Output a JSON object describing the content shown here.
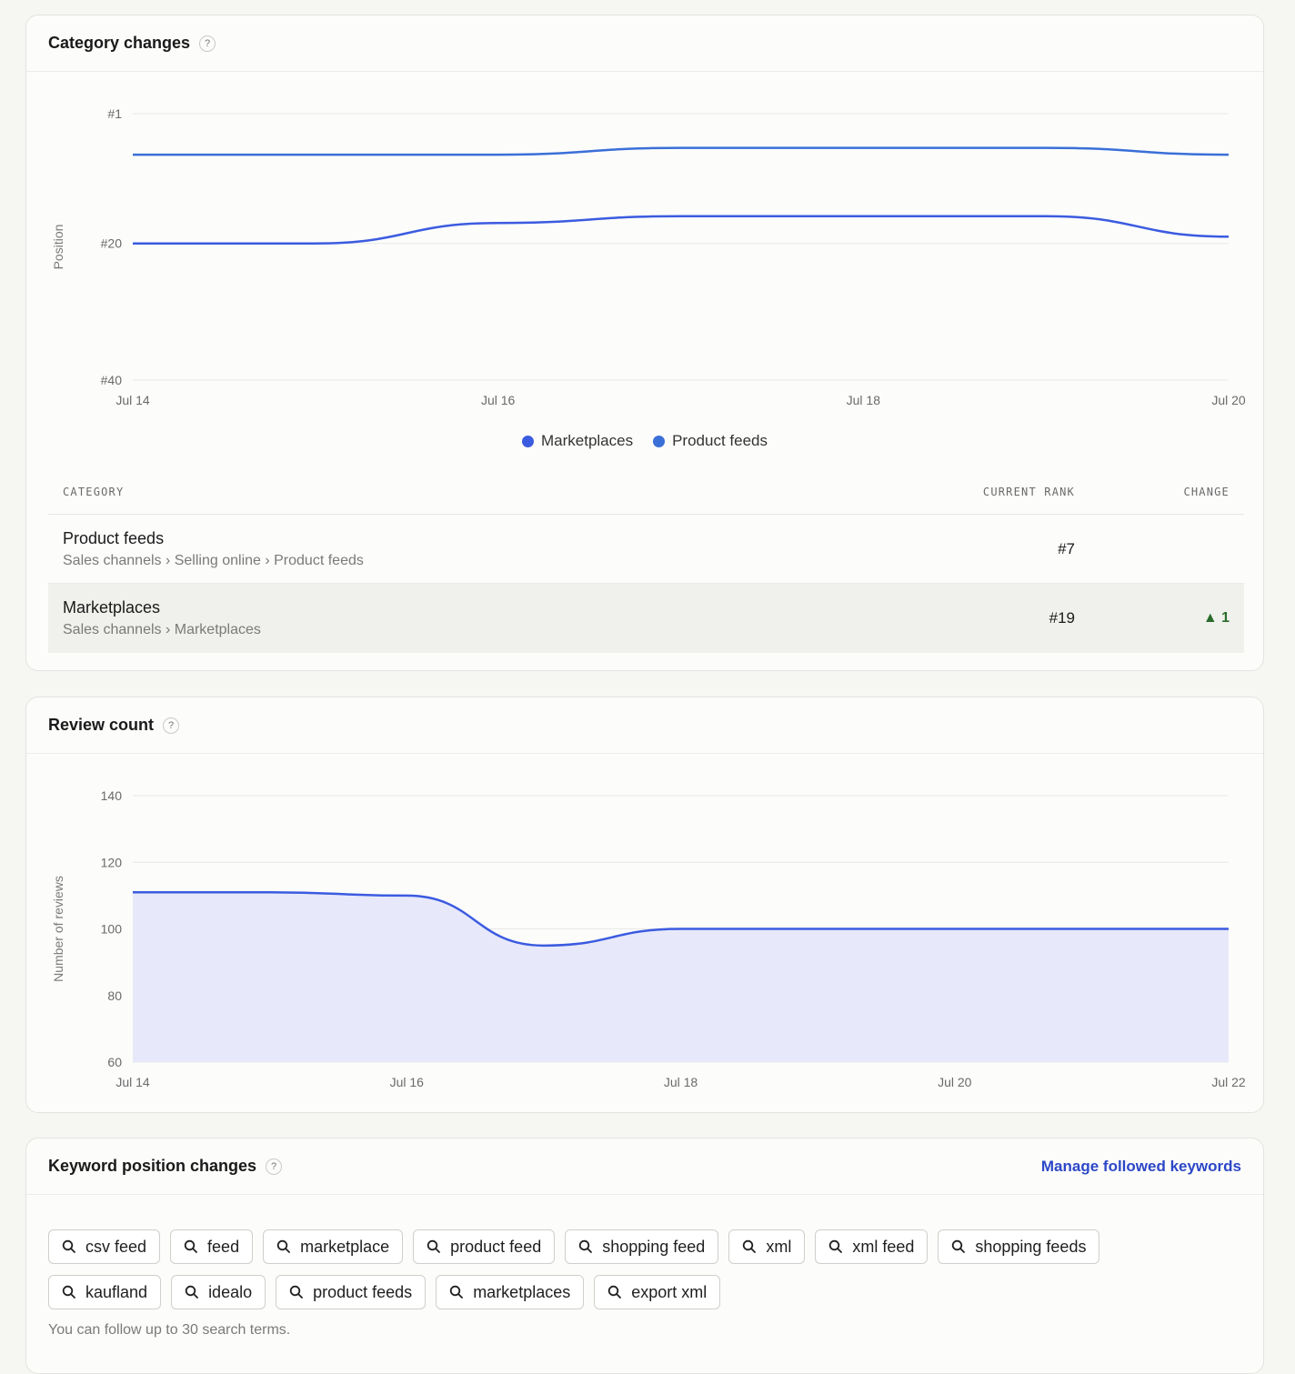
{
  "category_changes": {
    "title": "Category changes",
    "help_icon": "?",
    "chart_data": {
      "type": "line",
      "ylabel": "Position",
      "y_ticks": [
        "#1",
        "#20",
        "#40"
      ],
      "y_tick_values": [
        1,
        20,
        40
      ],
      "ylim": [
        1,
        40
      ],
      "y_inverted": true,
      "x_ticks": [
        "Jul 14",
        "Jul 16",
        "Jul 18",
        "Jul 20"
      ],
      "x": [
        "Jul 14",
        "Jul 15",
        "Jul 16",
        "Jul 17",
        "Jul 18",
        "Jul 19",
        "Jul 20"
      ],
      "series": [
        {
          "name": "Marketplaces",
          "color": "#3b5be0",
          "values": [
            20,
            20,
            17,
            16,
            16,
            16,
            19
          ]
        },
        {
          "name": "Product feeds",
          "color": "#3a6fd8",
          "values": [
            7,
            7,
            7,
            6,
            6,
            6,
            7
          ]
        }
      ],
      "grid": true,
      "legend_position": "bottom-center"
    },
    "legend": [
      {
        "label": "Marketplaces",
        "color": "#3b5be0"
      },
      {
        "label": "Product feeds",
        "color": "#3a6fd8"
      }
    ],
    "table": {
      "headers": {
        "category": "CATEGORY",
        "current_rank": "CURRENT RANK",
        "change": "CHANGE"
      },
      "rows": [
        {
          "name": "Product feeds",
          "path": "Sales channels › Selling online › Product feeds",
          "rank": "#7",
          "change": ""
        },
        {
          "name": "Marketplaces",
          "path": "Sales channels › Marketplaces",
          "rank": "#19",
          "change": "▲ 1"
        }
      ]
    }
  },
  "review_count": {
    "title": "Review count",
    "help_icon": "?",
    "chart_data": {
      "type": "area",
      "ylabel": "Number of reviews",
      "y_ticks": [
        "140",
        "120",
        "100",
        "80",
        "60"
      ],
      "ylim": [
        60,
        140
      ],
      "x_ticks": [
        "Jul 14",
        "Jul 16",
        "Jul 18",
        "Jul 20",
        "Jul 22"
      ],
      "x": [
        "Jul 14",
        "Jul 15",
        "Jul 16",
        "Jul 17",
        "Jul 18",
        "Jul 19",
        "Jul 20",
        "Jul 21",
        "Jul 22"
      ],
      "series": [
        {
          "name": "Reviews",
          "color": "#3b5be0",
          "values": [
            111,
            111,
            110,
            95,
            100,
            100,
            100,
            100,
            100
          ]
        }
      ],
      "grid": true
    }
  },
  "keyword_changes": {
    "title": "Keyword position changes",
    "help_icon": "?",
    "manage_link": "Manage followed keywords",
    "chip_icon": "search-icon",
    "keyword_rows": [
      [
        "csv feed",
        "feed",
        "marketplace",
        "product feed",
        "shopping feed",
        "xml",
        "xml feed",
        "shopping feeds"
      ],
      [
        "kaufland",
        "idealo",
        "product feeds",
        "marketplaces",
        "export xml"
      ]
    ],
    "hint": "You can follow up to 30 search terms."
  }
}
